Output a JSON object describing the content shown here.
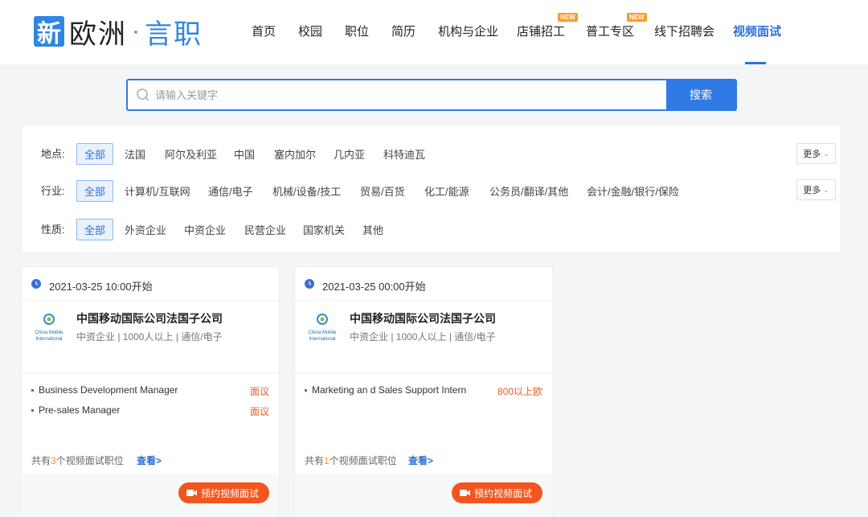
{
  "brand": {
    "logo_char": "新",
    "name": "欧洲",
    "dot": "·",
    "sub": "言职"
  },
  "nav": {
    "items": [
      {
        "label": "首页",
        "active": false
      },
      {
        "label": "校园",
        "active": false
      },
      {
        "label": "职位",
        "active": false
      },
      {
        "label": "简历",
        "active": false
      },
      {
        "label": "机构与企业",
        "active": false
      },
      {
        "label": "店铺招工",
        "active": false,
        "badge": "NEW"
      },
      {
        "label": "普工专区",
        "active": false,
        "badge": "NEW"
      },
      {
        "label": "线下招聘会",
        "active": false
      },
      {
        "label": "视频面试",
        "active": true
      }
    ],
    "accent": "#2f6fd8"
  },
  "search": {
    "placeholder": "请输入关键字",
    "value": "",
    "button": "搜索"
  },
  "filters": {
    "location": {
      "label": "地点:",
      "options": [
        "全部",
        "法国",
        "阿尔及利亚",
        "中国",
        "塞内加尔",
        "几内亚",
        "科特迪瓦"
      ],
      "selected": "全部",
      "more": "更多"
    },
    "industry": {
      "label": "行业:",
      "options": [
        "全部",
        "计算机/互联网",
        "通信/电子",
        "机械/设备/技工",
        "贸易/百货",
        "化工/能源",
        "公务员/翻译/其他",
        "会计/金融/银行/保险"
      ],
      "selected": "全部",
      "more": "更多"
    },
    "nature": {
      "label": "性质:",
      "options": [
        "全部",
        "外资企业",
        "中资企业",
        "民营企业",
        "国家机关",
        "其他"
      ],
      "selected": "全部"
    }
  },
  "cards": [
    {
      "time": "2021-03-25 10:00开始",
      "company": "中国移动国际公司法国子公司",
      "meta": "中资企业 | 1000人以上 | 通信/电子",
      "logo_lines": [
        "China Mobile",
        "International"
      ],
      "jobs": [
        {
          "title": "Business Development Manager",
          "salary": "面议"
        },
        {
          "title": "Pre-sales Manager",
          "salary": "面议"
        }
      ],
      "footer_pre": "共有",
      "footer_count": "3",
      "footer_post": "个视频面试职位",
      "view": "查看>",
      "book": "预约视频面试"
    },
    {
      "time": "2021-03-25 00:00开始",
      "company": "中国移动国际公司法国子公司",
      "meta": "中资企业 | 1000人以上 | 通信/电子",
      "logo_lines": [
        "China Mobile",
        "International"
      ],
      "jobs": [
        {
          "title": "Marketing an d Sales Support Intern",
          "salary": "800以上欧"
        }
      ],
      "footer_pre": "共有",
      "footer_count": "1",
      "footer_post": "个视频面试职位",
      "view": "查看>",
      "book": "预约视频面试"
    }
  ]
}
